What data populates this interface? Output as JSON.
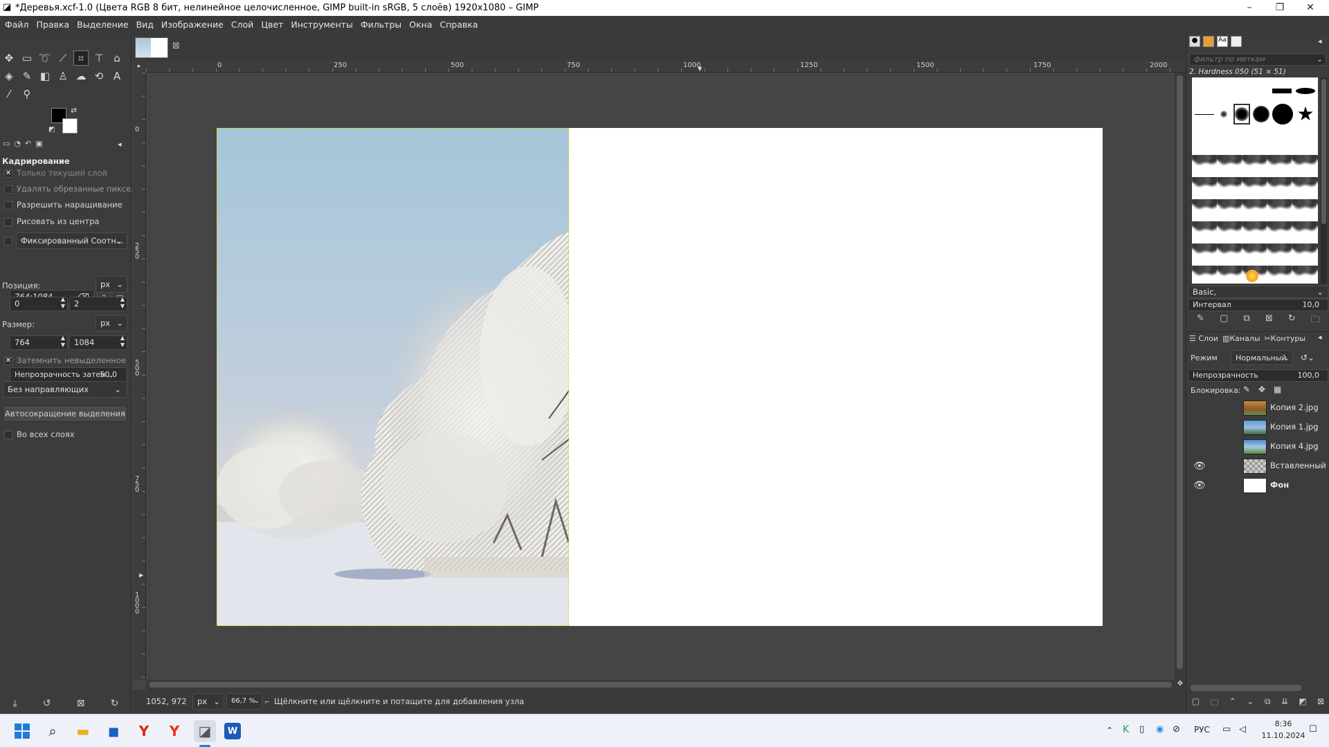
{
  "window": {
    "title": "*Деревья.xcf-1.0 (Цвета RGB 8 бит, нелинейное целочисленное, GIMP built-in sRGB, 5 слоёв) 1920x1080 – GIMP",
    "controls": [
      "–",
      "❐",
      "✕"
    ]
  },
  "menu": [
    "Файл",
    "Правка",
    "Выделение",
    "Вид",
    "Изображение",
    "Слой",
    "Цвет",
    "Инструменты",
    "Фильтры",
    "Окна",
    "Справка"
  ],
  "tool_options": {
    "title": "Кадрирование",
    "current_layer_only": "Только текущий слой",
    "delete_cropped": "Удалять обрезанные пиксели",
    "allow_growing": "Разрешить наращивание",
    "expand_from_center": "Рисовать из центра",
    "fixed_combo": "Фиксированный Соотн...",
    "ratio_value": "764:1084",
    "position_label": "Позиция:",
    "position_unit": "px",
    "position_x": "0",
    "position_y": "2",
    "size_label": "Размер:",
    "size_unit": "px",
    "size_w": "764",
    "size_h": "1084",
    "highlight": "Затемнить невыделенное",
    "highlight_opacity_label": "Непрозрачность затен...",
    "highlight_opacity_value": "50,0",
    "guides": "Без направляющих",
    "auto_shrink": "Автосокращение выделения",
    "shrink_merged": "Во всех слоях"
  },
  "rulers": {
    "h": [
      "0",
      "250",
      "500",
      "750",
      "1000",
      "1250",
      "1500",
      "1750",
      "2000"
    ],
    "v": [
      "0",
      "250",
      "500",
      "750",
      "1000"
    ]
  },
  "status": {
    "coords": "1052, 972",
    "unit": "px",
    "zoom": "66,7 %",
    "message": "Щёлкните или щёлкните и потащите для добавления узла"
  },
  "brushes": {
    "filter_placeholder": "фильтр по меткам",
    "selected": "2. Hardness 050 (51 × 51)",
    "preset": "Basic,",
    "spacing_label": "Интервал",
    "spacing_value": "10,0"
  },
  "layers_panel": {
    "tabs": [
      "Слои",
      "Каналы",
      "Контуры"
    ],
    "mode_label": "Режим",
    "mode_value": "Нормальный",
    "opacity_label": "Непрозрачность",
    "opacity_value": "100,0",
    "lock_label": "Блокировка:",
    "layers": [
      {
        "name": "Копия 2.jpg",
        "visible": false,
        "thumb": "autumn"
      },
      {
        "name": "Копия 1.jpg",
        "visible": false,
        "thumb": "sky"
      },
      {
        "name": "Копия 4.jpg",
        "visible": false,
        "thumb": "field"
      },
      {
        "name": "Вставленный сл",
        "visible": true,
        "thumb": "checker"
      },
      {
        "name": "Фон",
        "visible": true,
        "thumb": "white"
      }
    ]
  },
  "taskbar": {
    "apps": [
      "start-icon",
      "search-icon",
      "explorer-icon",
      "store-icon",
      "yandex-icon",
      "yandex-browser-icon",
      "gimp-icon",
      "word-icon"
    ],
    "lang": "РУС",
    "time": "8:36",
    "date": "11.10.2024"
  }
}
